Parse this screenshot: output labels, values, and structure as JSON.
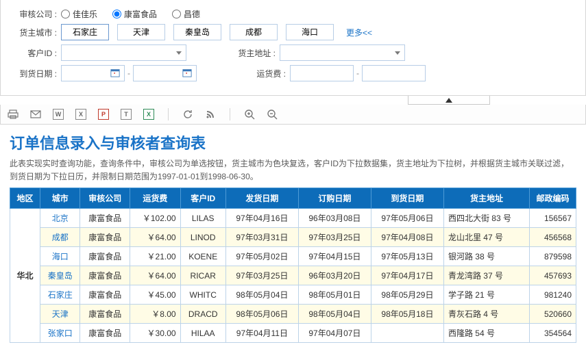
{
  "filters": {
    "company_label": "审核公司 :",
    "companies": [
      {
        "name": "佳佳乐",
        "checked": false
      },
      {
        "name": "康富食品",
        "checked": true
      },
      {
        "name": "昌德",
        "checked": false
      }
    ],
    "city_label": "货主城市 :",
    "cities": [
      "石家庄",
      "天津",
      "秦皇岛",
      "成都",
      "海口"
    ],
    "more": "更多<<",
    "customer_label": "客户ID :",
    "address_label": "货主地址 :",
    "arrival_label": "到货日期 :",
    "freight_label": "运货费 :",
    "sep": "-"
  },
  "report": {
    "title": "订单信息录入与审核者查询表",
    "desc": "此表实现实时查询功能，查询条件中，审核公司为单选按钮，货主城市为色块复选，客户ID为下拉数据集，货主地址为下拉树，并根据货主城市关联过滤，到货日期为下拉日历，并限制日期范围为1997-01-01到1998-06-30。"
  },
  "table": {
    "headers": [
      "地区",
      "城市",
      "审核公司",
      "运货费",
      "客户ID",
      "发货日期",
      "订购日期",
      "到货日期",
      "货主地址",
      "邮政编码"
    ],
    "region": "华北",
    "rows": [
      {
        "city": "北京",
        "company": "康富食品",
        "freight": "￥102.00",
        "cust": "LILAS",
        "ship": "97年04月16日",
        "order": "96年03月08日",
        "arrive": "97年05月06日",
        "addr": "西四北大街 83 号",
        "zip": "156567"
      },
      {
        "city": "成都",
        "company": "康富食品",
        "freight": "￥64.00",
        "cust": "LINOD",
        "ship": "97年03月31日",
        "order": "97年03月25日",
        "arrive": "97年04月08日",
        "addr": "龙山北里 47 号",
        "zip": "456568"
      },
      {
        "city": "海口",
        "company": "康富食品",
        "freight": "￥21.00",
        "cust": "KOENE",
        "ship": "97年05月02日",
        "order": "97年04月15日",
        "arrive": "97年05月13日",
        "addr": "银河路 38 号",
        "zip": "879598"
      },
      {
        "city": "秦皇岛",
        "company": "康富食品",
        "freight": "￥64.00",
        "cust": "RICAR",
        "ship": "97年03月25日",
        "order": "96年03月20日",
        "arrive": "97年04月17日",
        "addr": "青龙湾路 37 号",
        "zip": "457693"
      },
      {
        "city": "石家庄",
        "company": "康富食品",
        "freight": "￥45.00",
        "cust": "WHITC",
        "ship": "98年05月04日",
        "order": "98年05月01日",
        "arrive": "98年05月29日",
        "addr": "学子路 21 号",
        "zip": "981240"
      },
      {
        "city": "天津",
        "company": "康富食品",
        "freight": "￥8.00",
        "cust": "DRACD",
        "ship": "98年05月06日",
        "order": "98年05月04日",
        "arrive": "98年05月18日",
        "addr": "青灰石路 4 号",
        "zip": "520660"
      },
      {
        "city": "张家口",
        "company": "康富食品",
        "freight": "￥30.00",
        "cust": "HILAA",
        "ship": "97年04月11日",
        "order": "97年04月07日",
        "arrive": "",
        "addr": "西隆路 54 号",
        "zip": "354564"
      }
    ]
  },
  "icons": {
    "w": "W",
    "x": "X",
    "p": "P",
    "t": "T",
    "xg": "X"
  }
}
